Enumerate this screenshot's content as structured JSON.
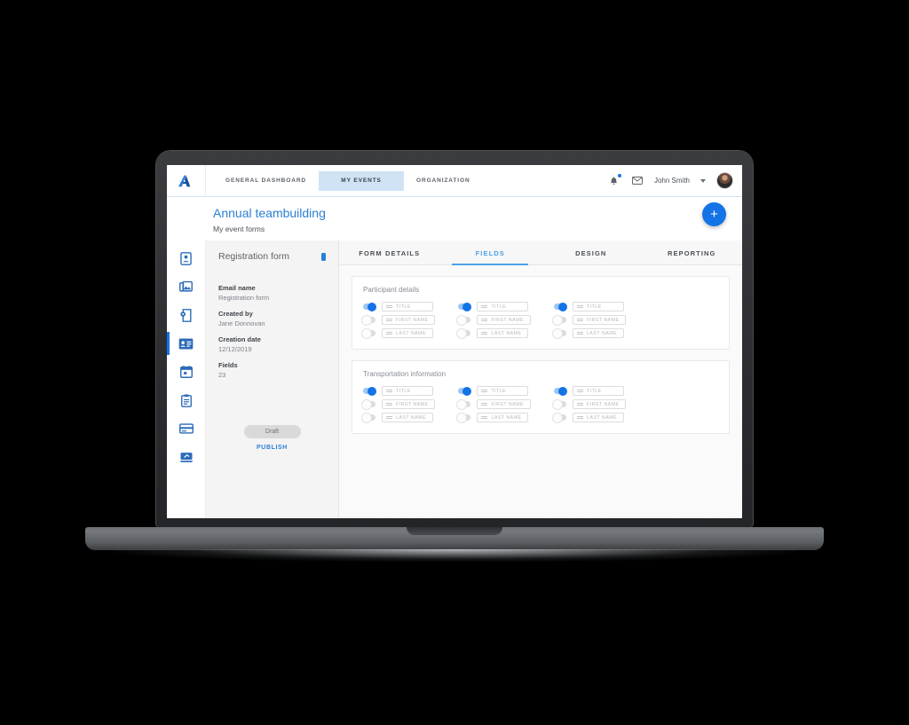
{
  "header": {
    "logo_icon": "brand-a-logo",
    "nav": [
      {
        "label": "GENERAL DASHBOARD",
        "active": false
      },
      {
        "label": "MY EVENTS",
        "active": true
      },
      {
        "label": "ORGANIZATION",
        "active": false
      }
    ],
    "notifications_icon": "bell-icon",
    "messages_icon": "envelope-icon",
    "user_name": "John Smith",
    "chevron_icon": "chevron-down-icon",
    "avatar_icon": "user-avatar"
  },
  "page": {
    "title": "Annual teambuilding",
    "subtitle": "My event forms",
    "add_button_label": "+"
  },
  "rail": {
    "items": [
      {
        "icon": "contact-card-icon",
        "active": false
      },
      {
        "icon": "photo-gallery-icon",
        "active": false
      },
      {
        "icon": "settings-document-icon",
        "active": false
      },
      {
        "icon": "id-badge-icon",
        "active": true
      },
      {
        "icon": "calendar-icon",
        "active": false
      },
      {
        "icon": "clipboard-icon",
        "active": false
      },
      {
        "icon": "credit-card-icon",
        "active": false
      },
      {
        "icon": "presentation-icon",
        "active": false
      }
    ]
  },
  "detail": {
    "title": "Registration form",
    "marker_icon": "status-marker",
    "fields": [
      {
        "label": "Email name",
        "value": "Registration form"
      },
      {
        "label": "Created by",
        "value": "Jane Donnovan"
      },
      {
        "label": "Creation date",
        "value": "12/12/2019"
      },
      {
        "label": "Fields",
        "value": "23"
      }
    ],
    "status_label": "Draft",
    "publish_label": "PUBLISH"
  },
  "tabs": [
    {
      "label": "FORM DETAILS",
      "active": false
    },
    {
      "label": "FIELDS",
      "active": true
    },
    {
      "label": "DESIGN",
      "active": false
    },
    {
      "label": "REPORTING",
      "active": false
    }
  ],
  "cards": [
    {
      "title": "Participant details",
      "columns": [
        {
          "fields": [
            {
              "label": "TITLE",
              "enabled": true
            },
            {
              "label": "FIRST NAME",
              "enabled": false
            },
            {
              "label": "LAST NAME",
              "enabled": false
            }
          ]
        },
        {
          "fields": [
            {
              "label": "TITLE",
              "enabled": true
            },
            {
              "label": "FIRST NAME",
              "enabled": false
            },
            {
              "label": "LAST NAME",
              "enabled": false
            }
          ]
        },
        {
          "fields": [
            {
              "label": "TITLE",
              "enabled": true
            },
            {
              "label": "FIRST NAME",
              "enabled": false
            },
            {
              "label": "LAST NAME",
              "enabled": false
            }
          ]
        }
      ]
    },
    {
      "title": "Transportation information",
      "columns": [
        {
          "fields": [
            {
              "label": "TITLE",
              "enabled": true
            },
            {
              "label": "FIRST NAME",
              "enabled": false
            },
            {
              "label": "LAST NAME",
              "enabled": false
            }
          ]
        },
        {
          "fields": [
            {
              "label": "TITLE",
              "enabled": true
            },
            {
              "label": "FIRST NAME",
              "enabled": false
            },
            {
              "label": "LAST NAME",
              "enabled": false
            }
          ]
        },
        {
          "fields": [
            {
              "label": "TITLE",
              "enabled": true
            },
            {
              "label": "FIRST NAME",
              "enabled": false
            },
            {
              "label": "LAST NAME",
              "enabled": false
            }
          ]
        }
      ]
    }
  ],
  "colors": {
    "accent": "#1473e6",
    "title_blue": "#2b7fd4",
    "tab_active": "#4da2e8",
    "nav_active_bg": "#cfe3f5",
    "panel_bg": "#fafafa"
  }
}
